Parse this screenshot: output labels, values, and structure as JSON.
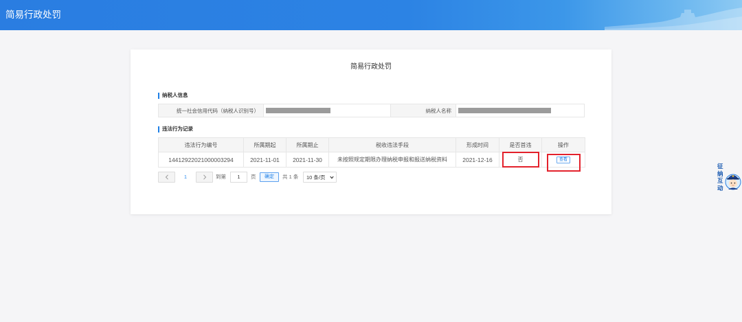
{
  "header": {
    "title": "简易行政处罚"
  },
  "card": {
    "title": "简易行政处罚"
  },
  "taxpayer_info": {
    "section_title": "纳税人信息",
    "credit_code_label": "统一社会信用代码（纳税人识别号）",
    "name_label": "纳税人名称"
  },
  "violations": {
    "section_title": "违法行为记录",
    "columns": [
      "违法行为编号",
      "所属期起",
      "所属期止",
      "税收违法手段",
      "形成时间",
      "是否首违",
      "操作"
    ],
    "rows": [
      {
        "id": "14412922021000003294",
        "period_start": "2021-11-01",
        "period_end": "2021-11-30",
        "means": "未按照规定期限办理纳税申报和报送纳税资料",
        "formed_at": "2021-12-16",
        "first_violation": "否",
        "action_label": "查看"
      }
    ]
  },
  "pagination": {
    "prev_icon": "chevron-left-icon",
    "current_page": "1",
    "next_icon": "chevron-right-icon",
    "goto_label": "到第",
    "goto_value": "1",
    "page_suffix": "页",
    "confirm_label": "确定",
    "total_label": "共 1 条",
    "page_size": "10 条/页"
  },
  "float_widget": {
    "label": "征纳互动",
    "icon": "tax-officer-avatar-icon"
  },
  "colors": {
    "header": "#2a7de1",
    "accent": "#1e7fe6",
    "annotation": "#e3212b",
    "redaction": "#9b9b9b"
  }
}
